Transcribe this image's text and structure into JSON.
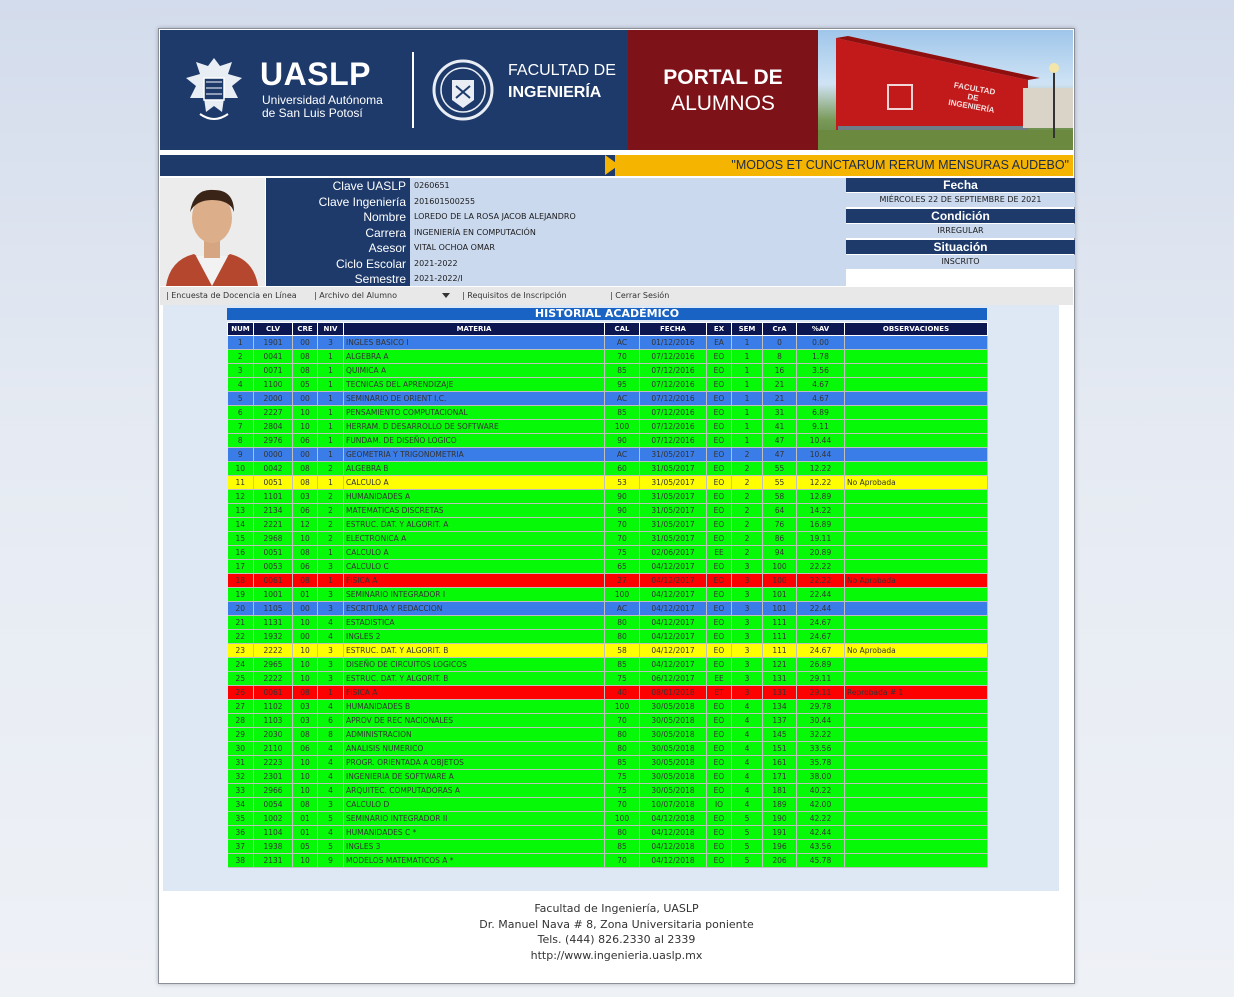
{
  "header": {
    "uaslp_word": "UASLP",
    "uaslp_sub1": "Universidad Autónoma",
    "uaslp_sub2": "de San Luis Potosí",
    "facultad_line1": "FACULTAD DE",
    "facultad_line2": "INGENIERÍA",
    "portal_line1": "PORTAL DE",
    "portal_line2": "ALUMNOS",
    "building_sign": [
      "FACULTAD",
      "DE",
      "INGENIERÍA"
    ],
    "brand_color": "#1d3a6b",
    "portal_color": "#7d1219"
  },
  "motto": "\"MODOS ET CUNCTARUM RERUM MENSURAS AUDEBO\"",
  "student": {
    "fields": [
      {
        "label": "Clave UASLP",
        "value": "0260651"
      },
      {
        "label": "Clave Ingeniería",
        "value": "201601500255"
      },
      {
        "label": "Nombre",
        "value": "LOREDO DE LA ROSA JACOB ALEJANDRO"
      },
      {
        "label": "Carrera",
        "value": "INGENIERÍA EN COMPUTACIÓN"
      },
      {
        "label": "Asesor",
        "value": "VITAL OCHOA OMAR"
      },
      {
        "label": "Ciclo Escolar",
        "value": "2021-2022"
      },
      {
        "label": "Semestre",
        "value": "2021-2022/I"
      }
    ]
  },
  "status": {
    "fecha_label": "Fecha",
    "fecha_value": "MIÉRCOLES 22 DE SEPTIEMBRE DE 2021",
    "condicion_label": "Condición",
    "condicion_value": "IRREGULAR",
    "situacion_label": "Situación",
    "situacion_value": "INSCRITO"
  },
  "menu": {
    "encuesta": "| Encuesta de Docencia en Línea",
    "archivo": "| Archivo del Alumno",
    "requisitos": "| Requisitos de Inscripción",
    "cerrar": "| Cerrar Sesión"
  },
  "historial": {
    "title": "HISTORIAL ACADÉMICO",
    "headers": [
      "NUM",
      "CLV",
      "CRE",
      "NIV",
      "MATERIA",
      "CAL",
      "FECHA",
      "EX",
      "SEM",
      "CrA",
      "%AV",
      "OBSERVACIONES"
    ],
    "row_colors": {
      "blue": "#3b7de8",
      "green": "#06f906",
      "yellow": "#ffff00",
      "red": "#ff0000"
    },
    "rows": [
      {
        "num": "1",
        "clv": "1901",
        "cre": "00",
        "niv": "3",
        "materia": "INGLES BASICO I",
        "cal": "AC",
        "fecha": "01/12/2016",
        "ex": "EA",
        "sem": "1",
        "cra": "0",
        "av": "0.00",
        "obs": "",
        "color": "blue"
      },
      {
        "num": "2",
        "clv": "0041",
        "cre": "08",
        "niv": "1",
        "materia": "ALGEBRA A",
        "cal": "70",
        "fecha": "07/12/2016",
        "ex": "EO",
        "sem": "1",
        "cra": "8",
        "av": "1.78",
        "obs": "",
        "color": "green"
      },
      {
        "num": "3",
        "clv": "0071",
        "cre": "08",
        "niv": "1",
        "materia": "QUIMICA A",
        "cal": "85",
        "fecha": "07/12/2016",
        "ex": "EO",
        "sem": "1",
        "cra": "16",
        "av": "3.56",
        "obs": "",
        "color": "green"
      },
      {
        "num": "4",
        "clv": "1100",
        "cre": "05",
        "niv": "1",
        "materia": "TECNICAS DEL APRENDIZAJE",
        "cal": "95",
        "fecha": "07/12/2016",
        "ex": "EO",
        "sem": "1",
        "cra": "21",
        "av": "4.67",
        "obs": "",
        "color": "green"
      },
      {
        "num": "5",
        "clv": "2000",
        "cre": "00",
        "niv": "1",
        "materia": "SEMINARIO DE ORIENT I.C.",
        "cal": "AC",
        "fecha": "07/12/2016",
        "ex": "EO",
        "sem": "1",
        "cra": "21",
        "av": "4.67",
        "obs": "",
        "color": "blue"
      },
      {
        "num": "6",
        "clv": "2227",
        "cre": "10",
        "niv": "1",
        "materia": "PENSAMIENTO COMPUTACIONAL",
        "cal": "85",
        "fecha": "07/12/2016",
        "ex": "EO",
        "sem": "1",
        "cra": "31",
        "av": "6.89",
        "obs": "",
        "color": "green"
      },
      {
        "num": "7",
        "clv": "2804",
        "cre": "10",
        "niv": "1",
        "materia": "HERRAM. D DESARROLLO DE SOFTWARE",
        "cal": "100",
        "fecha": "07/12/2016",
        "ex": "EO",
        "sem": "1",
        "cra": "41",
        "av": "9.11",
        "obs": "",
        "color": "green"
      },
      {
        "num": "8",
        "clv": "2976",
        "cre": "06",
        "niv": "1",
        "materia": "FUNDAM. DE DISEÑO LOGICO",
        "cal": "90",
        "fecha": "07/12/2016",
        "ex": "EO",
        "sem": "1",
        "cra": "47",
        "av": "10.44",
        "obs": "",
        "color": "green"
      },
      {
        "num": "9",
        "clv": "0000",
        "cre": "00",
        "niv": "1",
        "materia": "GEOMETRIA Y TRIGONOMETRIA",
        "cal": "AC",
        "fecha": "31/05/2017",
        "ex": "EO",
        "sem": "2",
        "cra": "47",
        "av": "10.44",
        "obs": "",
        "color": "blue"
      },
      {
        "num": "10",
        "clv": "0042",
        "cre": "08",
        "niv": "2",
        "materia": "ALGEBRA B",
        "cal": "60",
        "fecha": "31/05/2017",
        "ex": "EO",
        "sem": "2",
        "cra": "55",
        "av": "12.22",
        "obs": "",
        "color": "green"
      },
      {
        "num": "11",
        "clv": "0051",
        "cre": "08",
        "niv": "1",
        "materia": "CALCULO A",
        "cal": "53",
        "fecha": "31/05/2017",
        "ex": "EO",
        "sem": "2",
        "cra": "55",
        "av": "12.22",
        "obs": "No Aprobada",
        "color": "yellow"
      },
      {
        "num": "12",
        "clv": "1101",
        "cre": "03",
        "niv": "2",
        "materia": "HUMANIDADES A",
        "cal": "90",
        "fecha": "31/05/2017",
        "ex": "EO",
        "sem": "2",
        "cra": "58",
        "av": "12.89",
        "obs": "",
        "color": "green"
      },
      {
        "num": "13",
        "clv": "2134",
        "cre": "06",
        "niv": "2",
        "materia": "MATEMATICAS DISCRETAS",
        "cal": "90",
        "fecha": "31/05/2017",
        "ex": "EO",
        "sem": "2",
        "cra": "64",
        "av": "14.22",
        "obs": "",
        "color": "green"
      },
      {
        "num": "14",
        "clv": "2221",
        "cre": "12",
        "niv": "2",
        "materia": "ESTRUC. DAT. Y ALGORIT. A",
        "cal": "70",
        "fecha": "31/05/2017",
        "ex": "EO",
        "sem": "2",
        "cra": "76",
        "av": "16.89",
        "obs": "",
        "color": "green"
      },
      {
        "num": "15",
        "clv": "2968",
        "cre": "10",
        "niv": "2",
        "materia": "ELECTRONICA A",
        "cal": "70",
        "fecha": "31/05/2017",
        "ex": "EO",
        "sem": "2",
        "cra": "86",
        "av": "19.11",
        "obs": "",
        "color": "green"
      },
      {
        "num": "16",
        "clv": "0051",
        "cre": "08",
        "niv": "1",
        "materia": "CALCULO A",
        "cal": "75",
        "fecha": "02/06/2017",
        "ex": "EE",
        "sem": "2",
        "cra": "94",
        "av": "20.89",
        "obs": "",
        "color": "green"
      },
      {
        "num": "17",
        "clv": "0053",
        "cre": "06",
        "niv": "3",
        "materia": "CALCULO C",
        "cal": "65",
        "fecha": "04/12/2017",
        "ex": "EO",
        "sem": "3",
        "cra": "100",
        "av": "22.22",
        "obs": "",
        "color": "green"
      },
      {
        "num": "18",
        "clv": "0061",
        "cre": "08",
        "niv": "1",
        "materia": "FISICA A",
        "cal": "27",
        "fecha": "04/12/2017",
        "ex": "EO",
        "sem": "3",
        "cra": "100",
        "av": "22.22",
        "obs": "No Aprobada",
        "color": "red"
      },
      {
        "num": "19",
        "clv": "1001",
        "cre": "01",
        "niv": "3",
        "materia": "SEMINARIO INTEGRADOR I",
        "cal": "100",
        "fecha": "04/12/2017",
        "ex": "EO",
        "sem": "3",
        "cra": "101",
        "av": "22.44",
        "obs": "",
        "color": "green"
      },
      {
        "num": "20",
        "clv": "1105",
        "cre": "00",
        "niv": "3",
        "materia": "ESCRITURA Y REDACCION",
        "cal": "AC",
        "fecha": "04/12/2017",
        "ex": "EO",
        "sem": "3",
        "cra": "101",
        "av": "22.44",
        "obs": "",
        "color": "blue"
      },
      {
        "num": "21",
        "clv": "1131",
        "cre": "10",
        "niv": "4",
        "materia": "ESTADISTICA",
        "cal": "80",
        "fecha": "04/12/2017",
        "ex": "EO",
        "sem": "3",
        "cra": "111",
        "av": "24.67",
        "obs": "",
        "color": "green"
      },
      {
        "num": "22",
        "clv": "1932",
        "cre": "00",
        "niv": "4",
        "materia": "INGLES 2",
        "cal": "80",
        "fecha": "04/12/2017",
        "ex": "EO",
        "sem": "3",
        "cra": "111",
        "av": "24.67",
        "obs": "",
        "color": "green"
      },
      {
        "num": "23",
        "clv": "2222",
        "cre": "10",
        "niv": "3",
        "materia": "ESTRUC. DAT. Y ALGORIT. B",
        "cal": "58",
        "fecha": "04/12/2017",
        "ex": "EO",
        "sem": "3",
        "cra": "111",
        "av": "24.67",
        "obs": "No Aprobada",
        "color": "yellow"
      },
      {
        "num": "24",
        "clv": "2965",
        "cre": "10",
        "niv": "3",
        "materia": "DISEÑO DE CIRCUITOS LOGICOS",
        "cal": "85",
        "fecha": "04/12/2017",
        "ex": "EO",
        "sem": "3",
        "cra": "121",
        "av": "26.89",
        "obs": "",
        "color": "green"
      },
      {
        "num": "25",
        "clv": "2222",
        "cre": "10",
        "niv": "3",
        "materia": "ESTRUC. DAT. Y ALGORIT. B",
        "cal": "75",
        "fecha": "06/12/2017",
        "ex": "EE",
        "sem": "3",
        "cra": "131",
        "av": "29.11",
        "obs": "",
        "color": "green"
      },
      {
        "num": "26",
        "clv": "0061",
        "cre": "08",
        "niv": "1",
        "materia": "FISICA A",
        "cal": "40",
        "fecha": "08/01/2018",
        "ex": "ET",
        "sem": "3",
        "cra": "131",
        "av": "29.11",
        "obs": "Reprobada # 1",
        "color": "red"
      },
      {
        "num": "27",
        "clv": "1102",
        "cre": "03",
        "niv": "4",
        "materia": "HUMANIDADES B",
        "cal": "100",
        "fecha": "30/05/2018",
        "ex": "EO",
        "sem": "4",
        "cra": "134",
        "av": "29.78",
        "obs": "",
        "color": "green"
      },
      {
        "num": "28",
        "clv": "1103",
        "cre": "03",
        "niv": "6",
        "materia": "APROV DE REC NACIONALES",
        "cal": "70",
        "fecha": "30/05/2018",
        "ex": "EO",
        "sem": "4",
        "cra": "137",
        "av": "30.44",
        "obs": "",
        "color": "green"
      },
      {
        "num": "29",
        "clv": "2030",
        "cre": "08",
        "niv": "8",
        "materia": "ADMINISTRACION",
        "cal": "80",
        "fecha": "30/05/2018",
        "ex": "EO",
        "sem": "4",
        "cra": "145",
        "av": "32.22",
        "obs": "",
        "color": "green"
      },
      {
        "num": "30",
        "clv": "2110",
        "cre": "06",
        "niv": "4",
        "materia": "ANALISIS NUMERICO",
        "cal": "80",
        "fecha": "30/05/2018",
        "ex": "EO",
        "sem": "4",
        "cra": "151",
        "av": "33.56",
        "obs": "",
        "color": "green"
      },
      {
        "num": "31",
        "clv": "2223",
        "cre": "10",
        "niv": "4",
        "materia": "PROGR. ORIENTADA A OBJETOS",
        "cal": "85",
        "fecha": "30/05/2018",
        "ex": "EO",
        "sem": "4",
        "cra": "161",
        "av": "35.78",
        "obs": "",
        "color": "green"
      },
      {
        "num": "32",
        "clv": "2301",
        "cre": "10",
        "niv": "4",
        "materia": "INGENIERIA DE SOFTWARE A",
        "cal": "75",
        "fecha": "30/05/2018",
        "ex": "EO",
        "sem": "4",
        "cra": "171",
        "av": "38.00",
        "obs": "",
        "color": "green"
      },
      {
        "num": "33",
        "clv": "2966",
        "cre": "10",
        "niv": "4",
        "materia": "ARQUITEC. COMPUTADORAS A",
        "cal": "75",
        "fecha": "30/05/2018",
        "ex": "EO",
        "sem": "4",
        "cra": "181",
        "av": "40.22",
        "obs": "",
        "color": "green"
      },
      {
        "num": "34",
        "clv": "0054",
        "cre": "08",
        "niv": "3",
        "materia": "CALCULO D",
        "cal": "70",
        "fecha": "10/07/2018",
        "ex": "IO",
        "sem": "4",
        "cra": "189",
        "av": "42.00",
        "obs": "",
        "color": "green"
      },
      {
        "num": "35",
        "clv": "1002",
        "cre": "01",
        "niv": "5",
        "materia": "SEMINARIO INTEGRADOR II",
        "cal": "100",
        "fecha": "04/12/2018",
        "ex": "EO",
        "sem": "5",
        "cra": "190",
        "av": "42.22",
        "obs": "",
        "color": "green"
      },
      {
        "num": "36",
        "clv": "1104",
        "cre": "01",
        "niv": "4",
        "materia": "HUMANIDADES C *",
        "cal": "80",
        "fecha": "04/12/2018",
        "ex": "EO",
        "sem": "5",
        "cra": "191",
        "av": "42.44",
        "obs": "",
        "color": "green"
      },
      {
        "num": "37",
        "clv": "1938",
        "cre": "05",
        "niv": "5",
        "materia": "INGLES 3",
        "cal": "85",
        "fecha": "04/12/2018",
        "ex": "EO",
        "sem": "5",
        "cra": "196",
        "av": "43.56",
        "obs": "",
        "color": "green"
      },
      {
        "num": "38",
        "clv": "2131",
        "cre": "10",
        "niv": "9",
        "materia": "MODELOS MATEMATICOS A *",
        "cal": "70",
        "fecha": "04/12/2018",
        "ex": "EO",
        "sem": "5",
        "cra": "206",
        "av": "45.78",
        "obs": "",
        "color": "green"
      }
    ]
  },
  "footer": {
    "line1": "Facultad de Ingeniería, UASLP",
    "line2": "Dr. Manuel Nava # 8, Zona Universitaria poniente",
    "line3": "Tels. (444) 826.2330 al 2339",
    "line4": "http://www.ingenieria.uaslp.mx"
  }
}
